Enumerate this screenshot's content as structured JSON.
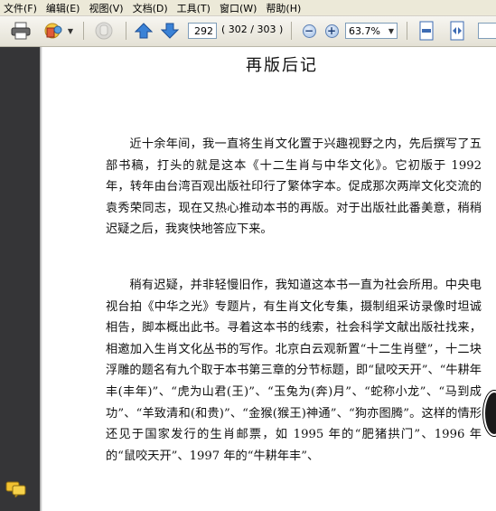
{
  "menu": {
    "items": [
      "文件(F)",
      "编辑(E)",
      "视图(V)",
      "文档(D)",
      "工具(T)",
      "窗口(W)",
      "帮助(H)"
    ]
  },
  "toolbar": {
    "page_input": "292",
    "page_count": "( 302 / 303 )",
    "zoom": "63.7%",
    "icons": [
      "print-icon",
      "stamp-icon",
      "hand-tool-icon",
      "prev-page-icon",
      "next-page-icon",
      "zoom-out-icon",
      "zoom-in-icon",
      "fit-page-icon",
      "fit-width-icon"
    ],
    "colors": {
      "arrow": "#2f6fc0",
      "zoom": "#4a74b4"
    }
  },
  "document": {
    "title": "再版后记",
    "paragraphs": [
      "近十余年间，我一直将生肖文化置于兴趣视野之内，先后撰写了五部书稿，打头的就是这本《十二生肖与中华文化》。它初版于 1992 年，转年由台湾百观出版社印行了繁体字本。促成那次两岸文化交流的袁秀荣同志，现在又热心推动本书的再版。对于出版社此番美意，稍稍迟疑之后，我爽快地答应下来。",
      "稍有迟疑，并非轻慢旧作，我知道这本书一直为社会所用。中央电视台拍《中华之光》专题片，有生肖文化专集，摄制组采访录像时坦诚相告，脚本概出此书。寻着这本书的线索，社会科学文献出版社找来，相邀加入生肖文化丛书的写作。北京白云观新置“十二生肖壁”，十二块浮雕的题名有九个取于本书第三章的分节标题，即“鼠咬天开”、“牛耕年丰(丰年)”、“虎为山君(王)”、“玉兔为(奔)月”、“蛇称小龙”、“马到成功”、“羊致清和(和贵)”、“金猴(猴王)神通”、“狗亦图腾”。这样的情形还见于国家发行的生肖邮票，如 1995 年的“肥猪拱门”、1996 年的“鼠咬天开”、1997 年的“牛耕年丰”、"
    ]
  },
  "sidebar": {
    "background": "#353537"
  }
}
